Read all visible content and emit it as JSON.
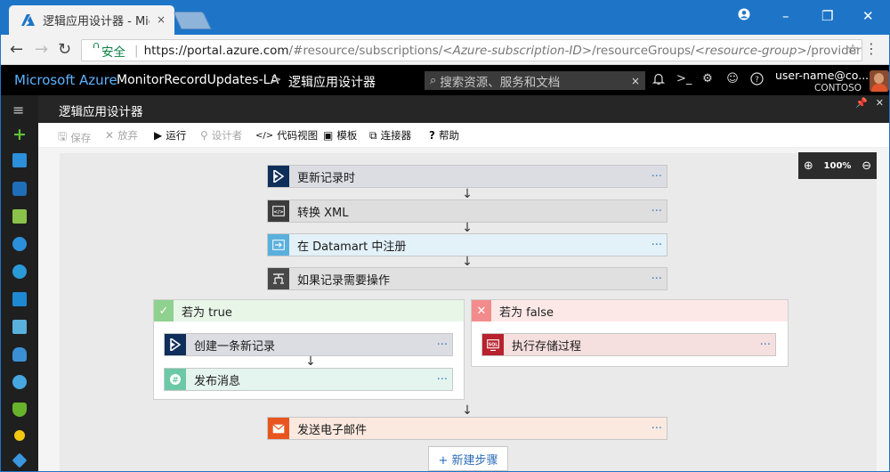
{
  "browser": {
    "tab_title": "逻辑应用设计器 - Micr",
    "tab_close": "×",
    "window_controls": {
      "account": "account-icon",
      "minimize": "–",
      "maximize": "❐",
      "close": "✕"
    },
    "secure_label": "安全",
    "url_host": "https://portal.azure.com",
    "url_parts": [
      "/#resource/subscriptions/",
      "<Azure-subscription-ID>",
      "/resourceGroups/",
      "<resource-group>",
      "/providers/Micro..."
    ]
  },
  "azure_header": {
    "brand": "Microsoft Azure",
    "breadcrumb_app": "MonitorRecordUpdates-LA",
    "breadcrumb_sep": ">",
    "breadcrumb_page": "逻辑应用设计器",
    "search_placeholder": "搜索资源、服务和文档",
    "search_clear": "×",
    "user_name": "user-name@co...",
    "user_org": "CONTOSO"
  },
  "blade": {
    "title": "逻辑应用设计器",
    "commands": [
      {
        "label": "保存",
        "icon": "save-icon",
        "enabled": false
      },
      {
        "label": "放弃",
        "icon": "discard-icon",
        "enabled": false
      },
      {
        "label": "运行",
        "icon": "run-icon",
        "enabled": true
      },
      {
        "label": "设计者",
        "icon": "designer-icon",
        "enabled": false
      },
      {
        "label": "代码视图",
        "icon": "code-icon",
        "enabled": true
      },
      {
        "label": "模板",
        "icon": "template-icon",
        "enabled": true
      },
      {
        "label": "连接器",
        "icon": "connector-icon",
        "enabled": true
      },
      {
        "label": "帮助",
        "icon": "help-icon",
        "enabled": true
      }
    ]
  },
  "zoom": {
    "level": "100%"
  },
  "workflow": {
    "steps": [
      {
        "label": "更新记录时",
        "icon": "dynamics-icon",
        "color": "#0f2e5a",
        "bg": "#dcdde3"
      },
      {
        "label": "转换 XML",
        "icon": "xml-icon",
        "color": "#3c3c3c",
        "bg": "#dedede"
      },
      {
        "label": "在 Datamart 中注册",
        "icon": "register-icon",
        "color": "#5ab0dc",
        "bg": "#e3f1f8"
      },
      {
        "label": "如果记录需要操作",
        "icon": "condition-icon",
        "color": "#484848",
        "bg": "#e0e0e0"
      }
    ],
    "branch_true": {
      "label": "若为 true",
      "color": "#8fd18f",
      "steps": [
        {
          "label": "创建一条新记录",
          "icon": "dynamics-icon",
          "color": "#0f2e5a",
          "bg": "#dcdde3"
        },
        {
          "label": "发布消息",
          "icon": "message-icon",
          "color": "#6bc9a8",
          "bg": "#e4f4ee"
        }
      ]
    },
    "branch_false": {
      "label": "若为 false",
      "color": "#f28b8b",
      "steps": [
        {
          "label": "执行存储过程",
          "icon": "sql-procedure-icon",
          "color": "#b8222c",
          "bg": "#f6dfdf"
        }
      ]
    },
    "final_step": {
      "label": "发送电子邮件",
      "icon": "mail-icon",
      "color": "#e8551f",
      "bg": "#fbe9df"
    },
    "more_label": "···",
    "new_step_label": "+ 新建步骤"
  }
}
